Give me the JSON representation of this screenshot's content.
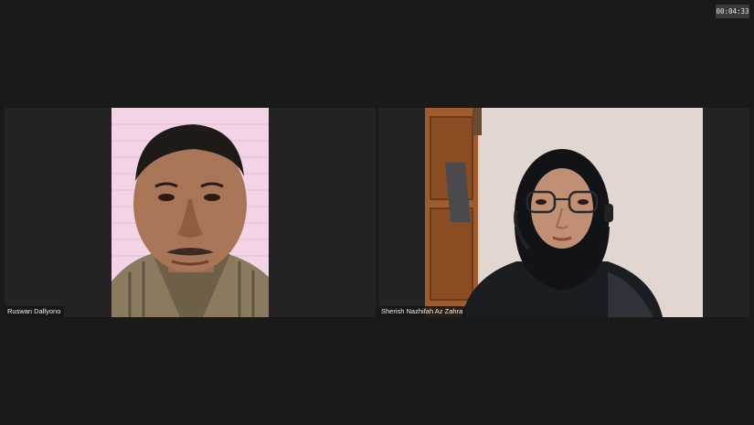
{
  "meeting": {
    "timer": "00:04:33"
  },
  "participants": [
    {
      "name": "Ruswan Dallyono",
      "video": "camera-on"
    },
    {
      "name": "Sherish Nazhifah Az Zahra",
      "video": "camera-on"
    }
  ],
  "colors": {
    "background": "#1a1a1a",
    "tile": "#232323",
    "label_bg": "#141414",
    "label_text": "#f0f0f0"
  }
}
